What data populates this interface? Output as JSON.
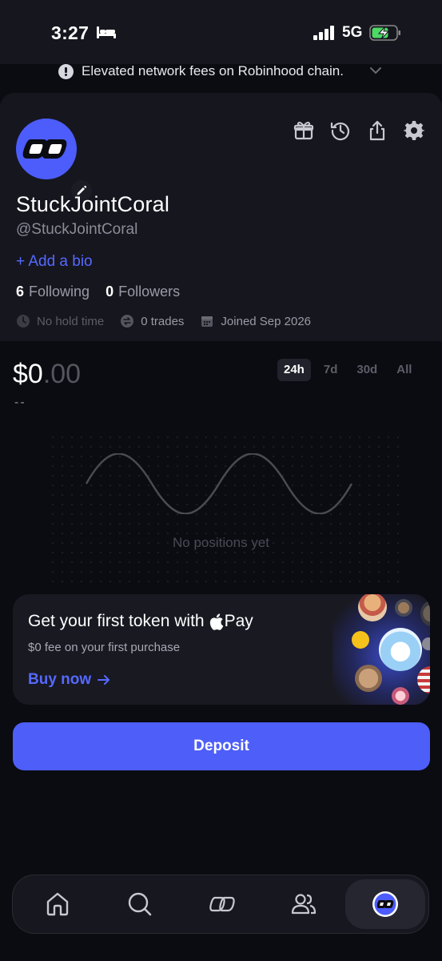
{
  "status_bar": {
    "time": "3:27",
    "network": "5G"
  },
  "alert": {
    "text": "Elevated network fees on Robinhood chain."
  },
  "profile": {
    "display_name": "StuckJointCoral",
    "handle": "@StuckJointCoral",
    "add_bio": "+ Add a bio",
    "following_count": "6",
    "following_label": "Following",
    "followers_count": "0",
    "followers_label": "Followers",
    "hold_time": "No hold time",
    "trades": "0 trades",
    "joined": "Joined Sep 2026"
  },
  "portfolio": {
    "balance_main": "$0",
    "balance_cents": ".00",
    "change": "--",
    "ranges": [
      "24h",
      "7d",
      "30d",
      "All"
    ],
    "selected_range": "24h",
    "empty_text": "No positions yet"
  },
  "promo": {
    "title": "Get your first token with",
    "pay_label": "Pay",
    "subtitle": "$0 fee on your first purchase",
    "cta": "Buy now"
  },
  "deposit_label": "Deposit",
  "nav": {
    "items": [
      "home-icon",
      "search-icon",
      "logo-icon",
      "people-icon",
      "profile-avatar-icon"
    ],
    "active": "profile-avatar-icon"
  },
  "colors": {
    "accent": "#4d5ef9",
    "link": "#5569ff",
    "background": "#0b0b12",
    "card": "#16161f"
  }
}
